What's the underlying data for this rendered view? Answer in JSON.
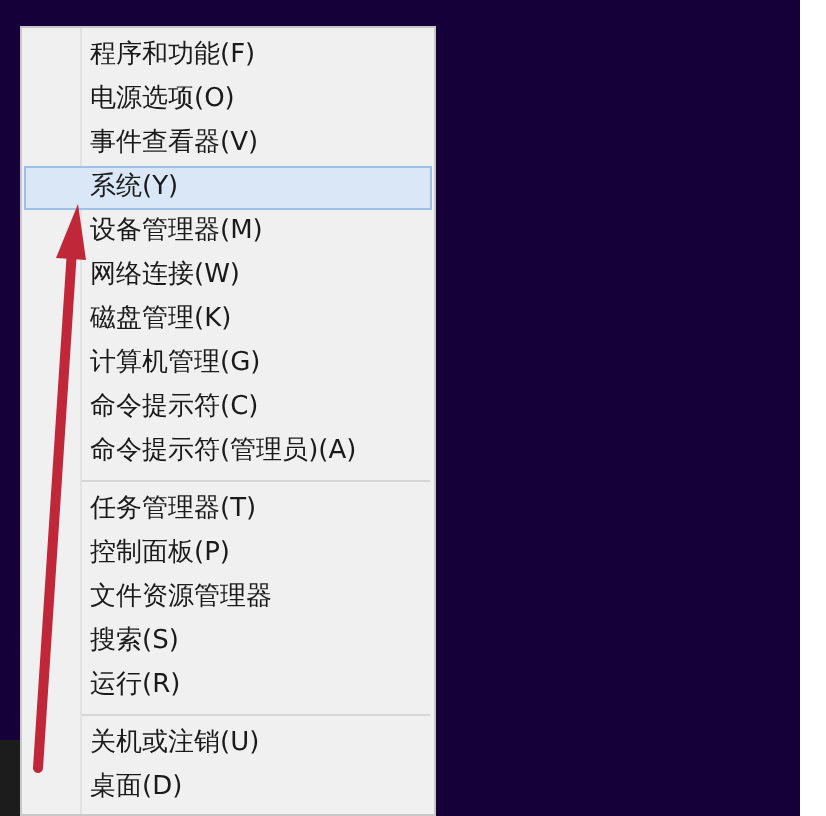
{
  "context_menu": {
    "groups": [
      {
        "items": [
          {
            "label": "程序和功能(F)",
            "selected": false
          },
          {
            "label": "电源选项(O)",
            "selected": false
          },
          {
            "label": "事件查看器(V)",
            "selected": false
          },
          {
            "label": "系统(Y)",
            "selected": true
          },
          {
            "label": "设备管理器(M)",
            "selected": false
          },
          {
            "label": "网络连接(W)",
            "selected": false
          },
          {
            "label": "磁盘管理(K)",
            "selected": false
          },
          {
            "label": "计算机管理(G)",
            "selected": false
          },
          {
            "label": "命令提示符(C)",
            "selected": false
          },
          {
            "label": "命令提示符(管理员)(A)",
            "selected": false
          }
        ]
      },
      {
        "items": [
          {
            "label": "任务管理器(T)",
            "selected": false
          },
          {
            "label": "控制面板(P)",
            "selected": false
          },
          {
            "label": "文件资源管理器",
            "selected": false
          },
          {
            "label": "搜索(S)",
            "selected": false
          },
          {
            "label": "运行(R)",
            "selected": false
          }
        ]
      },
      {
        "items": [
          {
            "label": "关机或注销(U)",
            "selected": false
          },
          {
            "label": "桌面(D)",
            "selected": false
          }
        ]
      }
    ]
  }
}
